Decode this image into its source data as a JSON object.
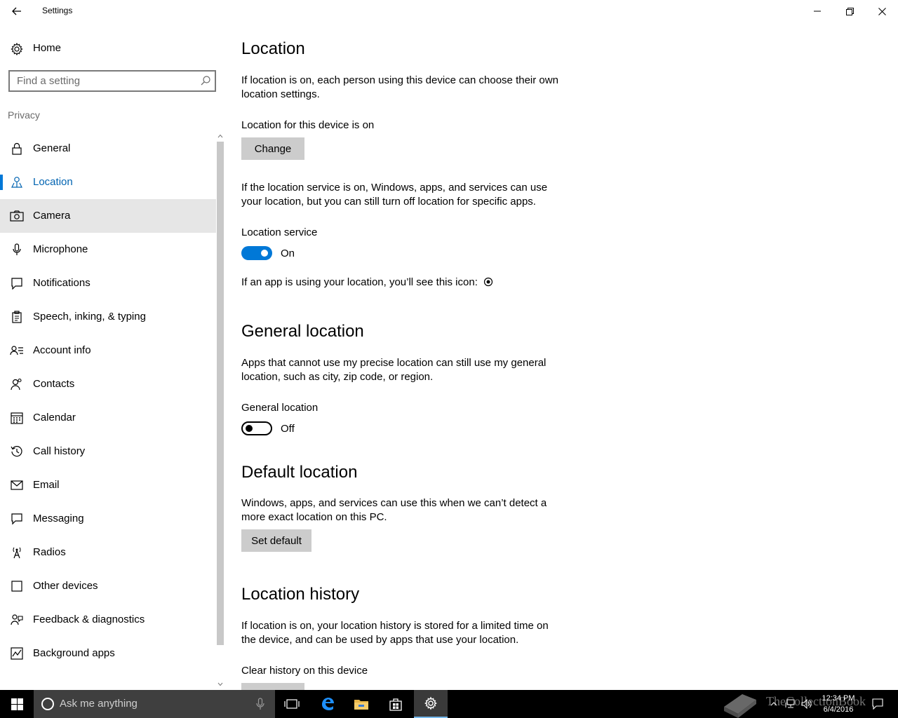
{
  "window": {
    "title": "Settings"
  },
  "sidebar": {
    "home_label": "Home",
    "search_placeholder": "Find a setting",
    "section_header": "Privacy",
    "items": [
      {
        "label": "General",
        "icon": "lock-icon"
      },
      {
        "label": "Location",
        "icon": "location-person-icon",
        "active": true
      },
      {
        "label": "Camera",
        "icon": "camera-icon",
        "hover": true
      },
      {
        "label": "Microphone",
        "icon": "microphone-icon"
      },
      {
        "label": "Notifications",
        "icon": "notification-icon"
      },
      {
        "label": "Speech, inking, & typing",
        "icon": "clipboard-icon"
      },
      {
        "label": "Account info",
        "icon": "account-info-icon"
      },
      {
        "label": "Contacts",
        "icon": "contacts-icon"
      },
      {
        "label": "Calendar",
        "icon": "calendar-icon"
      },
      {
        "label": "Call history",
        "icon": "history-icon"
      },
      {
        "label": "Email",
        "icon": "mail-icon"
      },
      {
        "label": "Messaging",
        "icon": "message-icon"
      },
      {
        "label": "Radios",
        "icon": "radio-tower-icon"
      },
      {
        "label": "Other devices",
        "icon": "devices-icon"
      },
      {
        "label": "Feedback & diagnostics",
        "icon": "feedback-icon"
      },
      {
        "label": "Background apps",
        "icon": "background-apps-icon"
      }
    ]
  },
  "content": {
    "location": {
      "heading": "Location",
      "intro": "If location is on, each person using this device can choose their own location settings.",
      "device_status": "Location for this device is on",
      "change_button": "Change",
      "service_desc": "If the location service is on, Windows, apps, and services can use your location, but you can still turn off location for specific apps.",
      "service_label": "Location service",
      "service_state": "On",
      "icon_note": "If an app is using your location, you’ll see this icon:"
    },
    "general_location": {
      "heading": "General location",
      "desc": "Apps that cannot use my precise location can still use my general location, such as city, zip code, or region.",
      "toggle_label": "General location",
      "toggle_state": "Off"
    },
    "default_location": {
      "heading": "Default location",
      "desc": "Windows, apps, and services can use this when we can’t detect a more exact location on this PC.",
      "button": "Set default"
    },
    "location_history": {
      "heading": "Location history",
      "desc": "If location is on, your location history is stored for a limited time on the device, and can be used by apps that use your location.",
      "clear_label": "Clear history on this device"
    }
  },
  "taskbar": {
    "search_placeholder": "Ask me anything",
    "time": "12:34 PM",
    "date": "6/4/2016",
    "accent_color": "#76b9ed"
  },
  "watermark": {
    "text": "TheCollectionBook"
  },
  "colors": {
    "accent": "#0078d7",
    "active_text": "#0063b1",
    "button_bg": "#cccccc",
    "hover_bg": "#e6e6e6"
  }
}
